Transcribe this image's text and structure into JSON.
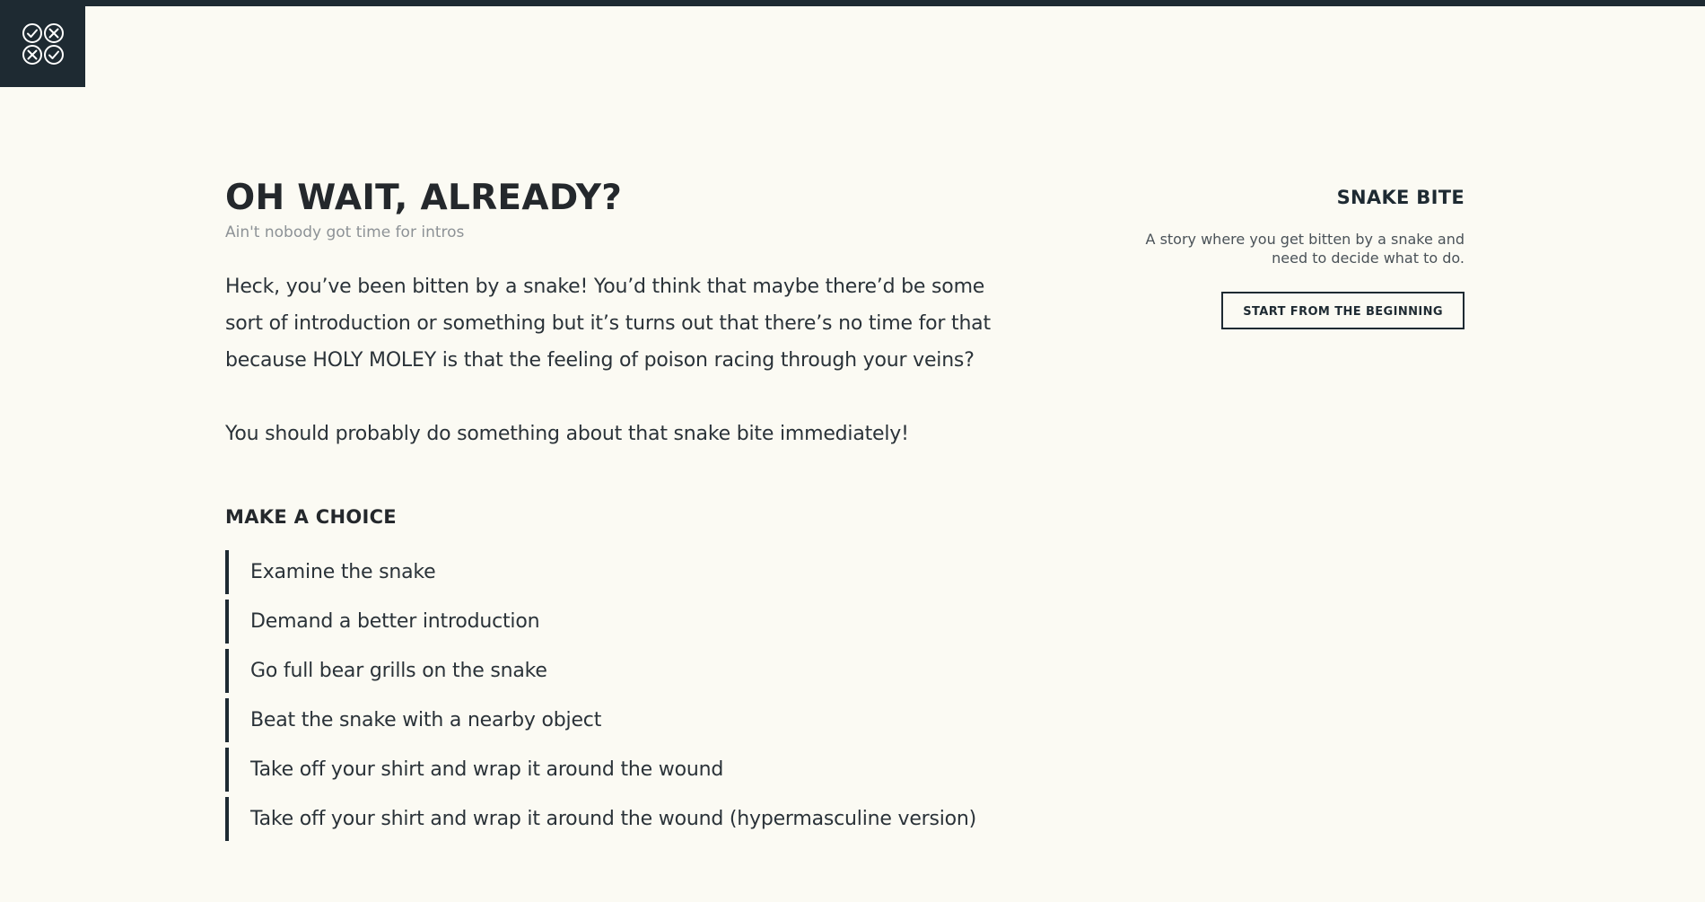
{
  "logo": {
    "icon": "check-cross-grid-icon"
  },
  "main": {
    "title": "OH WAIT, ALREADY?",
    "subtitle": "Ain't nobody got time for intros",
    "paragraphs": [
      "Heck, you’ve been bitten by a snake! You’d think that maybe there’d be some sort of introduction or something but it’s turns out that there’s no time for that because HOLY MOLEY is that the feeling of poison racing through your veins?",
      "You should probably do something about that snake bite immediately!"
    ]
  },
  "choices": {
    "heading": "MAKE A CHOICE",
    "items": [
      "Examine the snake",
      "Demand a better introduction",
      "Go full bear grills on the snake",
      "Beat the snake with a nearby object",
      "Take off your shirt and wrap it around the wound",
      "Take off your shirt and wrap it around the wound (hypermasculine version)"
    ]
  },
  "sidebar": {
    "title": "SNAKE BITE",
    "description": "A story where you get bitten by a snake and need to decide what to do.",
    "restart_label": "START FROM THE BEGINNING"
  },
  "colors": {
    "background": "#fbfaf3",
    "dark": "#1e2a32",
    "muted": "#8d9296"
  }
}
